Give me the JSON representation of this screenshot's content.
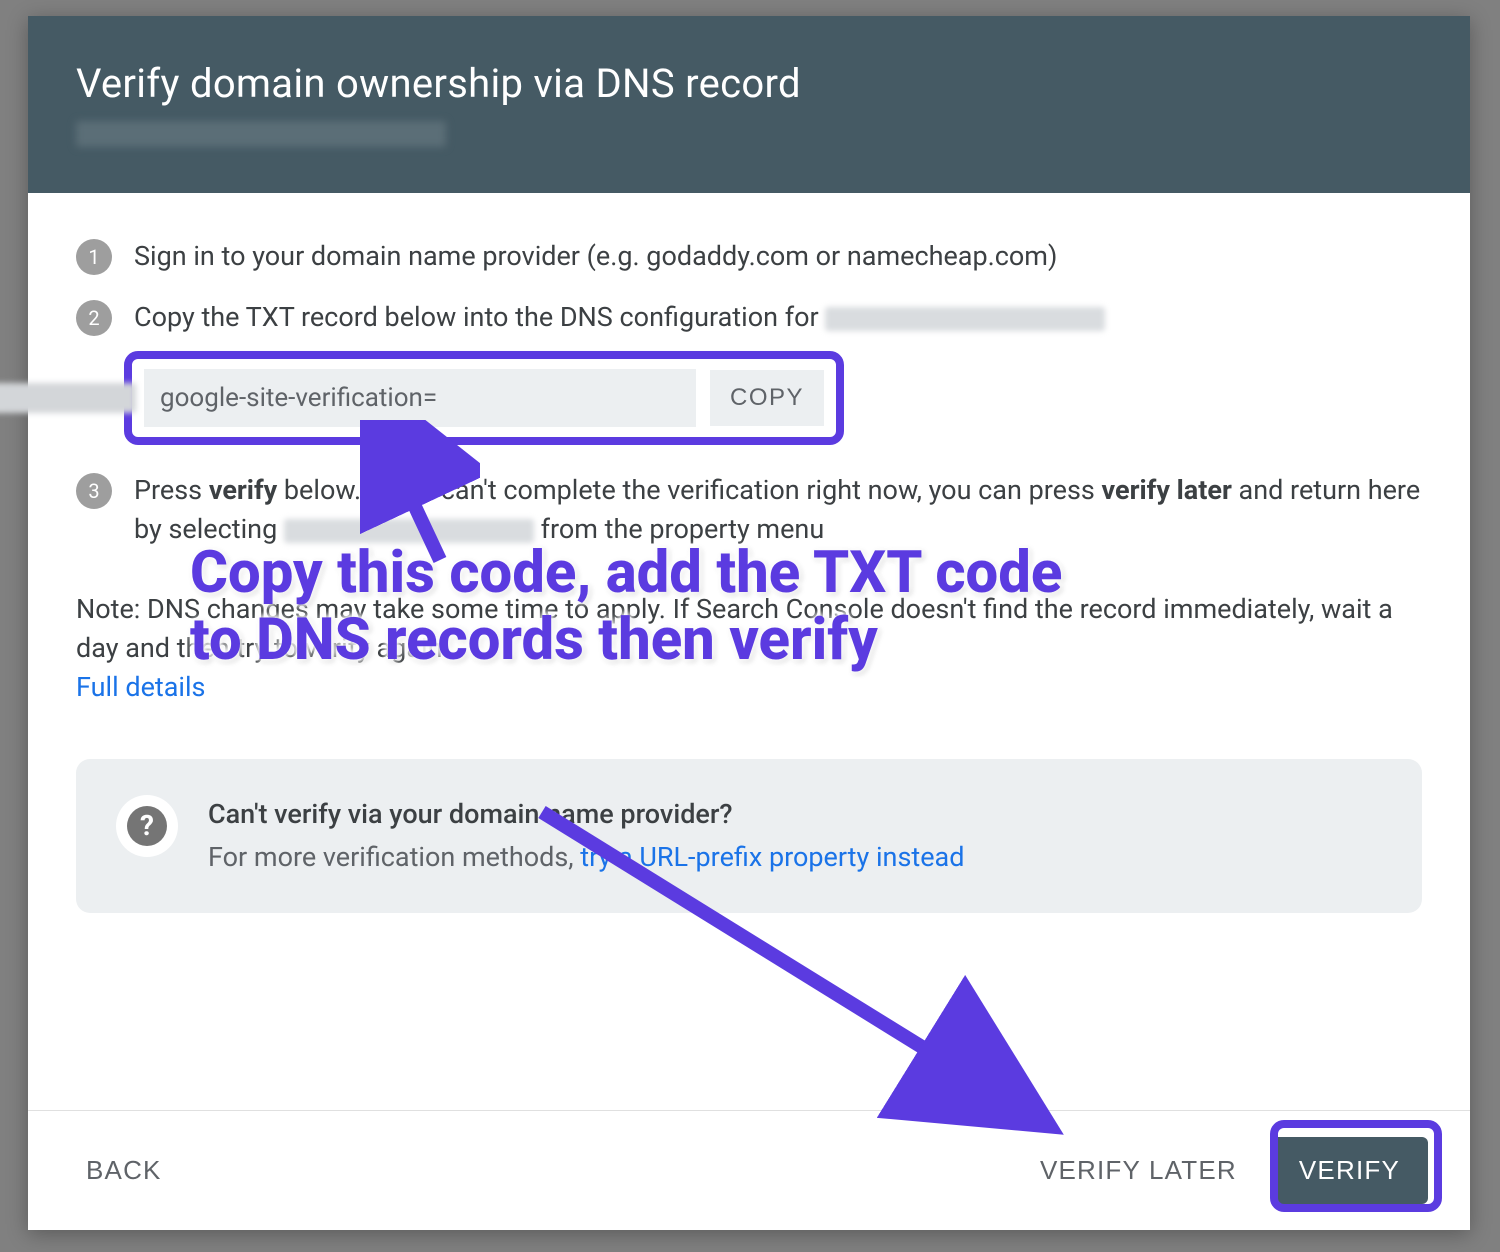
{
  "header": {
    "title": "Verify domain ownership via DNS record"
  },
  "steps": {
    "s1": {
      "num": "1",
      "text": "Sign in to your domain name provider (e.g. godaddy.com or namecheap.com)"
    },
    "s2": {
      "num": "2",
      "text": "Copy the TXT record below into the DNS configuration for "
    },
    "s3": {
      "num": "3",
      "pre": "Press ",
      "verify_word": "verify",
      "mid": " below. If you can't complete the verification right now, you can press ",
      "verify_later_word": "verify later",
      "mid2": " and return here by selecting ",
      "post": " from the property menu"
    }
  },
  "txt": {
    "value": "google-site-verification=",
    "copy_label": "COPY"
  },
  "note": {
    "text": "Note: DNS changes may take some time to apply. If Search Console doesn't find the record immediately, wait a day and then try to verify again",
    "full_details": "Full details"
  },
  "tip": {
    "title": "Can't verify via your domain name provider?",
    "sub_pre": "For more verification methods, ",
    "sub_link": "try a URL-prefix property instead"
  },
  "footer": {
    "back": "BACK",
    "verify_later": "VERIFY LATER",
    "verify": "VERIFY"
  },
  "annotation": "Copy this code, add the TXT code to DNS records then verify"
}
